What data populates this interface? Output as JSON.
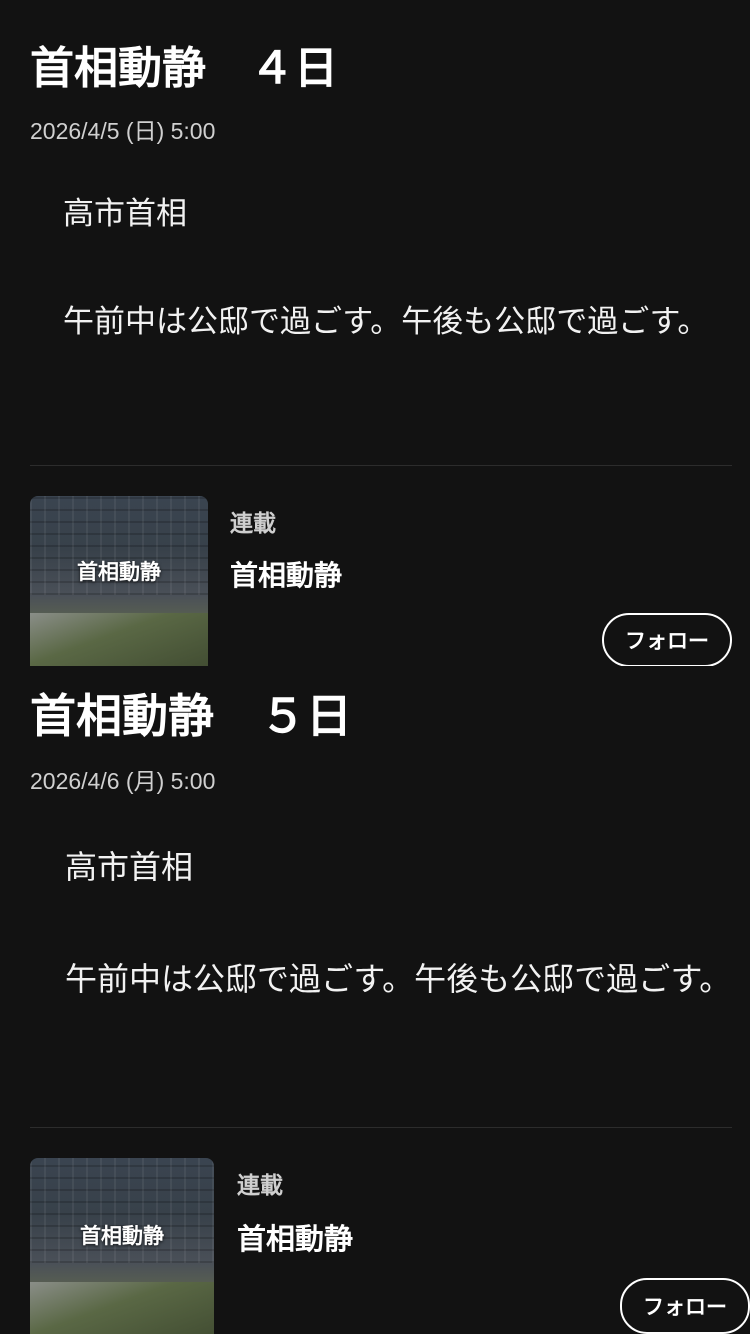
{
  "articles": [
    {
      "title": "首相動静　４日",
      "date": "2026/4/5 (日) 5:00",
      "paragraphs": [
        "　高市首相",
        "　午前中は公邸で過ごす。午後も公邸で過ごす。"
      ],
      "series": {
        "tag": "連載",
        "name": "首相動静",
        "thumb_label": "首相動静",
        "follow_label": "フォロー"
      }
    },
    {
      "title": "首相動静　５日",
      "date": "2026/4/6 (月) 5:00",
      "paragraphs": [
        "　高市首相",
        "　午前中は公邸で過ごす。午後も公邸で過ごす。"
      ],
      "series": {
        "tag": "連載",
        "name": "首相動静",
        "thumb_label": "首相動静",
        "follow_label": "フォロー"
      }
    }
  ]
}
